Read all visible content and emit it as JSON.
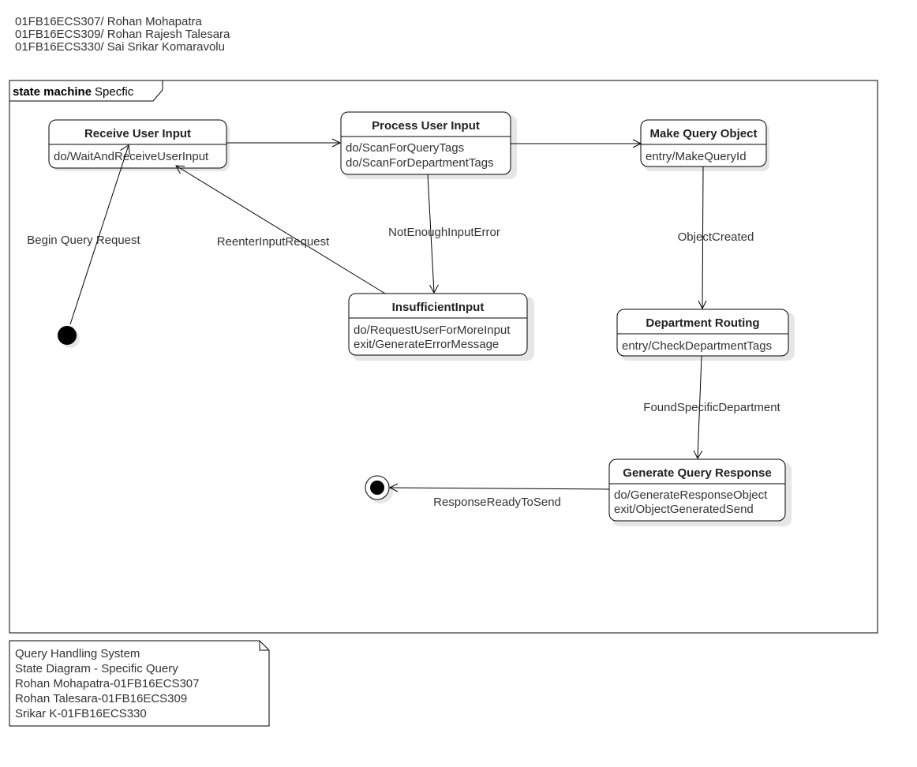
{
  "authors": [
    "01FB16ECS307/ Rohan Mohapatra",
    "01FB16ECS309/ Rohan Rajesh Talesara",
    "01FB16ECS330/ Sai Srikar Komaravolu"
  ],
  "frame": {
    "keyword": "state machine",
    "name": "Specfic"
  },
  "states": {
    "receive": {
      "title": "Receive User Input",
      "activities": [
        "do/WaitAndReceiveUserInput"
      ]
    },
    "process": {
      "title": "Process User Input",
      "activities": [
        "do/ScanForQueryTags",
        "do/ScanForDepartmentTags"
      ]
    },
    "make": {
      "title": "Make Query Object",
      "activities": [
        "entry/MakeQueryId"
      ]
    },
    "insufficient": {
      "title": "InsufficientInput",
      "activities": [
        "do/RequestUserForMoreInput",
        "exit/GenerateErrorMessage"
      ]
    },
    "routing": {
      "title": "Department Routing",
      "activities": [
        "entry/CheckDepartmentTags"
      ]
    },
    "generate": {
      "title": "Generate Query Response",
      "activities": [
        "do/GenerateResponseObject",
        "exit/ObjectGeneratedSend"
      ]
    }
  },
  "transitions": {
    "begin": "Begin Query Request",
    "reenter": "ReenterInputRequest",
    "not_enough": "NotEnoughInputError",
    "object_created": "ObjectCreated",
    "found_dept": "FoundSpecificDepartment",
    "response_ready": "ResponseReadyToSend"
  },
  "note": [
    "Query Handling System",
    "State Diagram - Specific Query",
    "Rohan Mohapatra-01FB16ECS307",
    "Rohan Talesara-01FB16ECS309",
    "Srikar K-01FB16ECS330"
  ],
  "colors": {
    "line": "#000000",
    "shadow": "#e6e6e6",
    "text": "#222222"
  }
}
